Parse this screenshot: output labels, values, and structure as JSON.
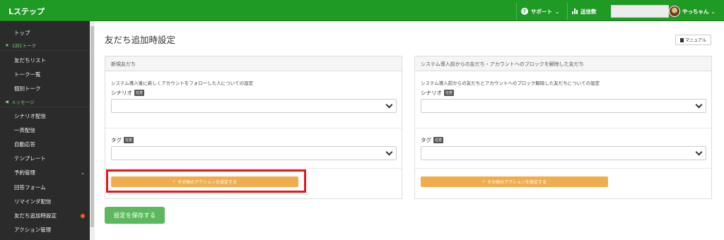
{
  "header": {
    "brand": "Lステップ",
    "support_label": "サポート",
    "sent_label": "送信数",
    "user_name": "やっちゃん",
    "bg_color": "#1f9a24"
  },
  "sidebar": {
    "top": "トップ",
    "section_1on1": "1対1トーク",
    "friends_list": "友だちリスト",
    "talk_list": "トーク一覧",
    "individual_talk": "個別トーク",
    "section_message": "メッセージ",
    "scenario": "シナリオ配信",
    "broadcast": "一斉配信",
    "auto_reply": "自動応答",
    "template": "テンプレート",
    "reservation": "予約管理",
    "answer_form": "回答フォーム",
    "reminder": "リマインダ配信",
    "friend_add_settings": "友だち追加時設定",
    "action_manage": "アクション管理"
  },
  "main": {
    "title": "友だち追加時設定",
    "manual_label": "マニュアル",
    "save_label": "設定を保存する"
  },
  "panels": [
    {
      "header": "新規友だち",
      "description": "システム導入後に新しくアカウントをフォローした人についての設定",
      "scenario_label": "シナリオ",
      "tag_label": "タグ",
      "optional_badge": "任意",
      "action_label": "その他のアクションを設定する"
    },
    {
      "header": "システム導入前からの友だち・アカウントへのブロックを解除した友だち",
      "description": "システム導入前からの友だちとアカウントへのブロック解除した友だちについての設定",
      "scenario_label": "シナリオ",
      "tag_label": "タグ",
      "optional_badge": "任意",
      "action_label": "その他のアクションを設定する"
    }
  ]
}
